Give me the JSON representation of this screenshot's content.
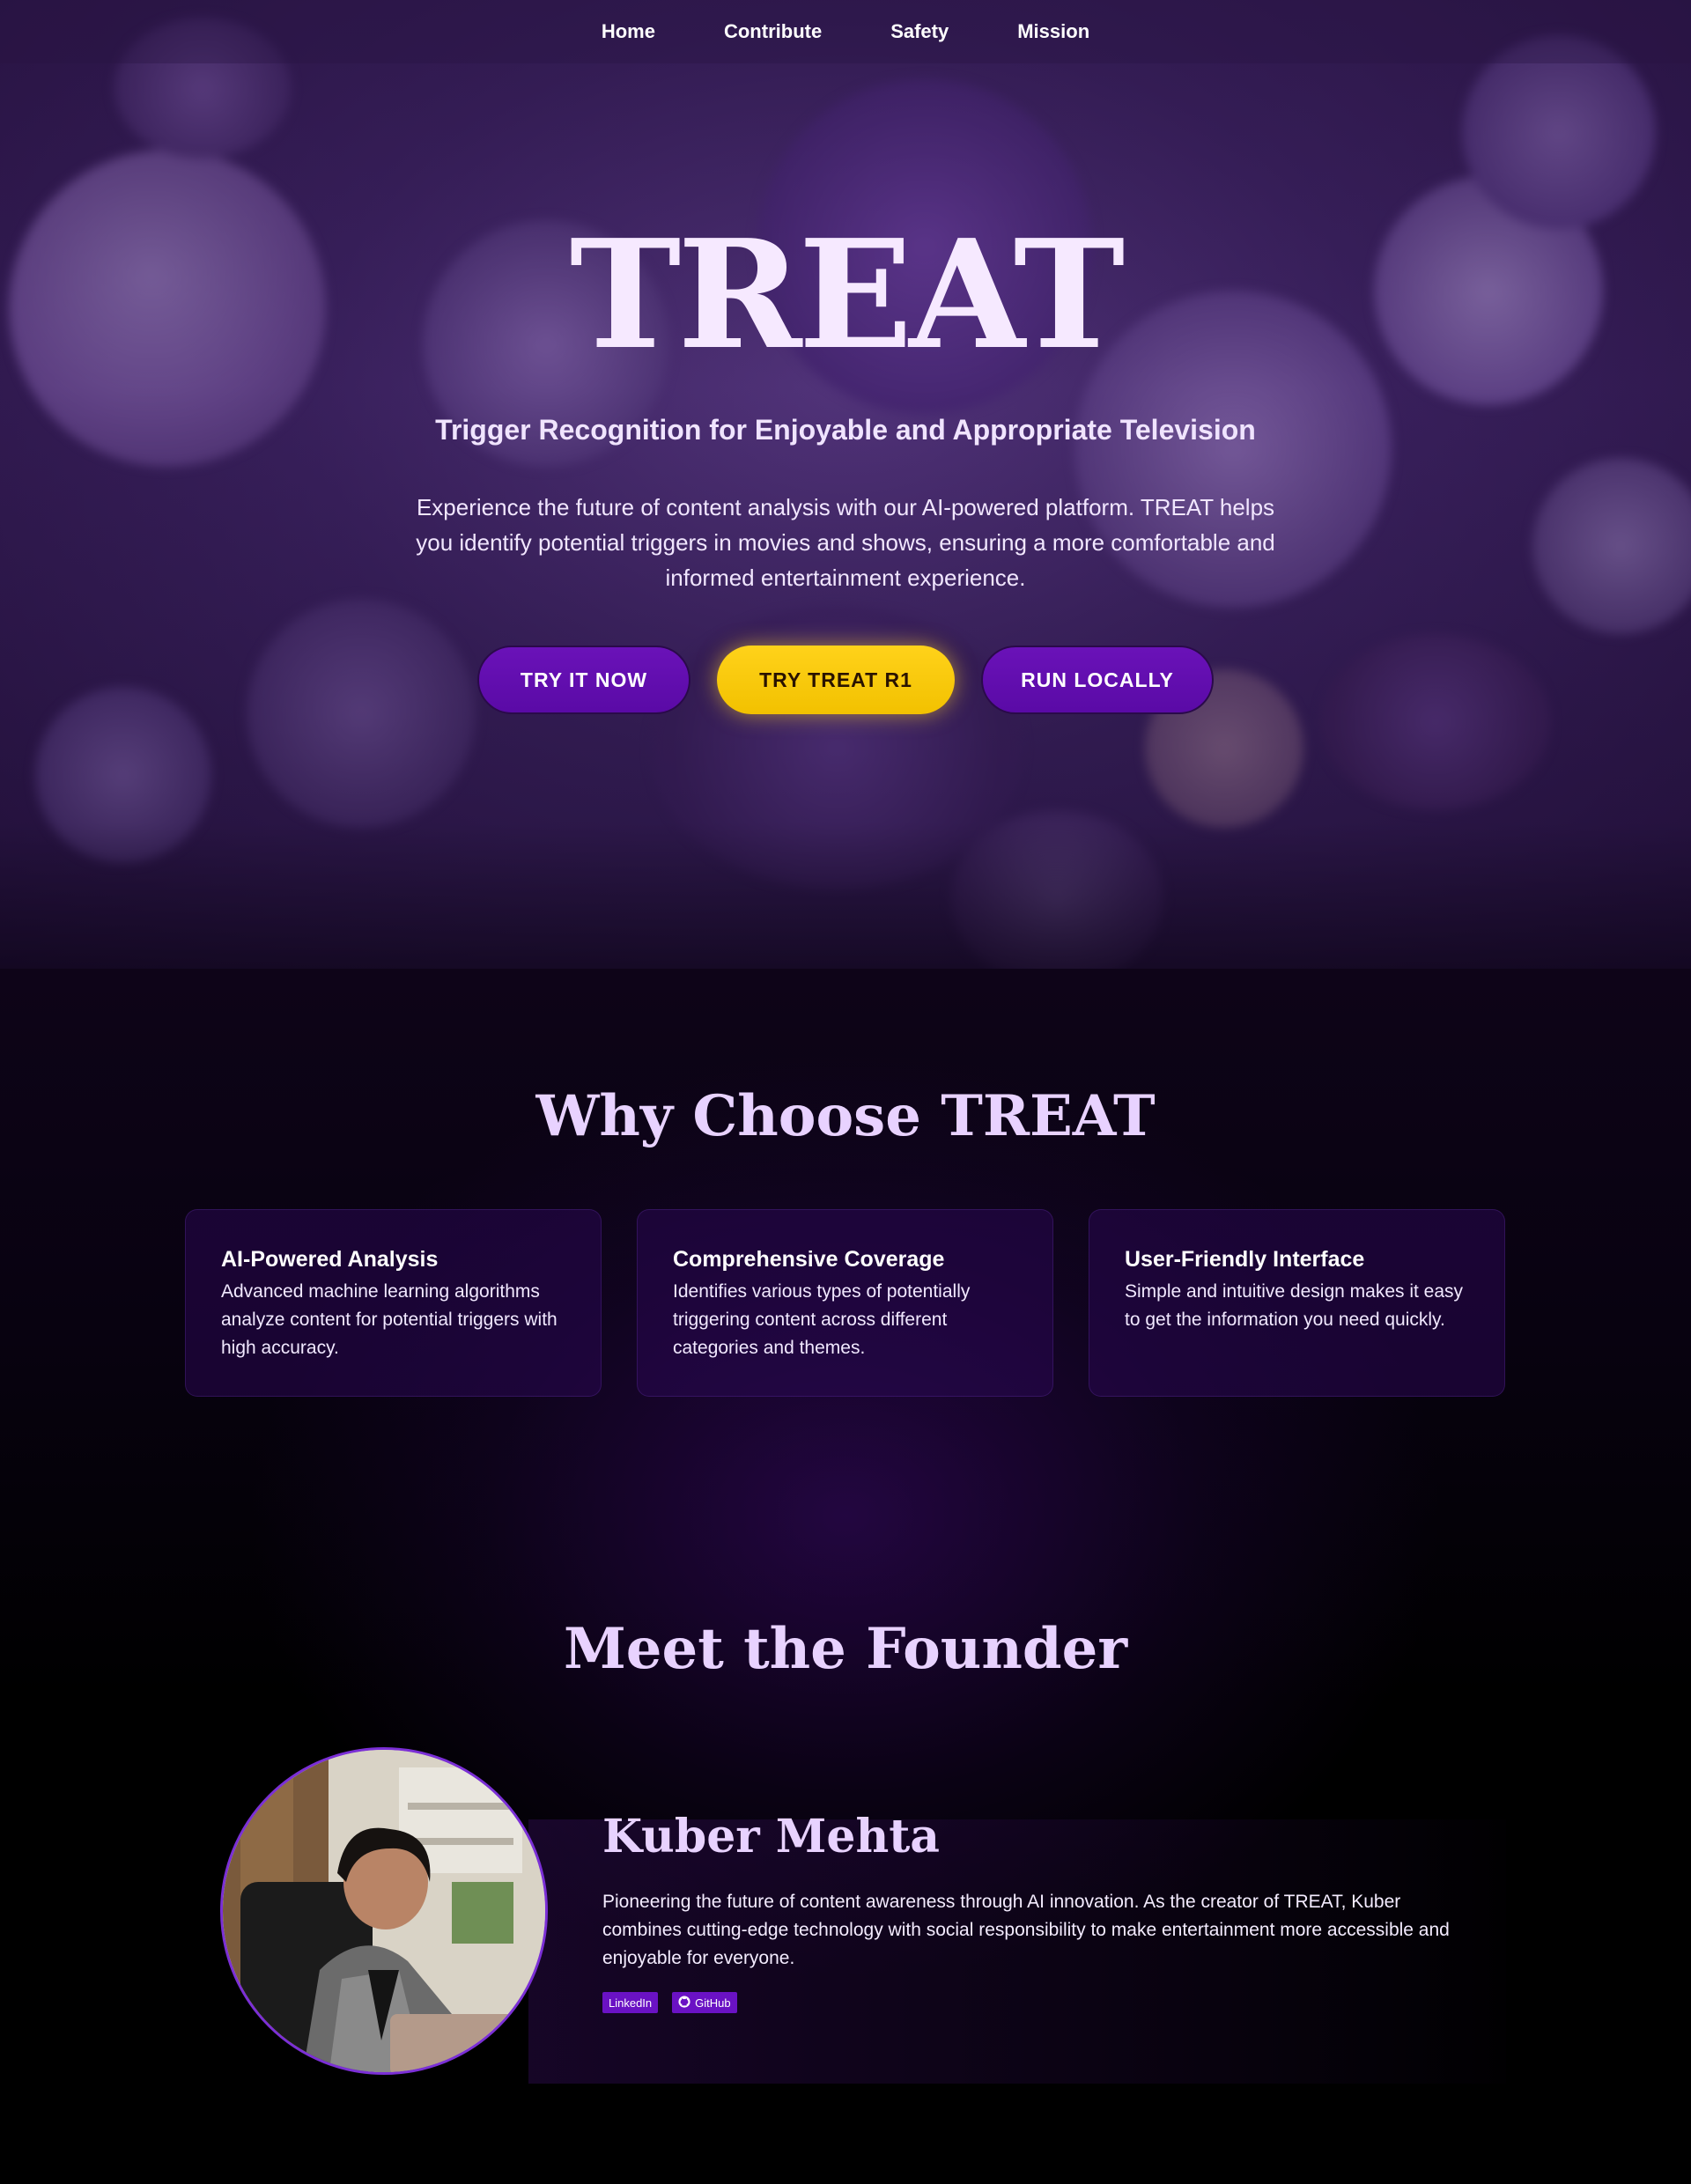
{
  "nav": {
    "items": [
      "Home",
      "Contribute",
      "Safety",
      "Mission"
    ]
  },
  "hero": {
    "title": "TREAT",
    "subtitle": "Trigger Recognition for Enjoyable and Appropriate Television",
    "description": "Experience the future of content analysis with our AI-powered platform. TREAT helps you identify potential triggers in movies and shows, ensuring a more comfortable and informed entertainment experience.",
    "buttons": {
      "try_now": "TRY IT NOW",
      "try_r1": "TRY TREAT R1",
      "run_locally": "RUN LOCALLY"
    }
  },
  "why": {
    "title": "Why Choose TREAT",
    "cards": [
      {
        "title": "AI-Powered Analysis",
        "text": "Advanced machine learning algorithms analyze content for potential triggers with high accuracy."
      },
      {
        "title": "Comprehensive Coverage",
        "text": "Identifies various types of potentially triggering content across different categories and themes."
      },
      {
        "title": "User-Friendly Interface",
        "text": "Simple and intuitive design makes it easy to get the information you need quickly."
      }
    ]
  },
  "founder": {
    "title": "Meet the Founder",
    "name": "Kuber Mehta",
    "bio": "Pioneering the future of content awareness through AI innovation. As the creator of TREAT, Kuber combines cutting-edge technology with social responsibility to make entertainment more accessible and enjoyable for everyone.",
    "links": {
      "linkedin": "LinkedIn",
      "github": "GitHub"
    }
  },
  "colors": {
    "accent_purple": "#6a12c4",
    "accent_yellow": "#ffd21a",
    "heading_lilac": "#e8d2ff",
    "hero_bg": "#3d2363"
  },
  "icons": {
    "github": "github-icon"
  }
}
